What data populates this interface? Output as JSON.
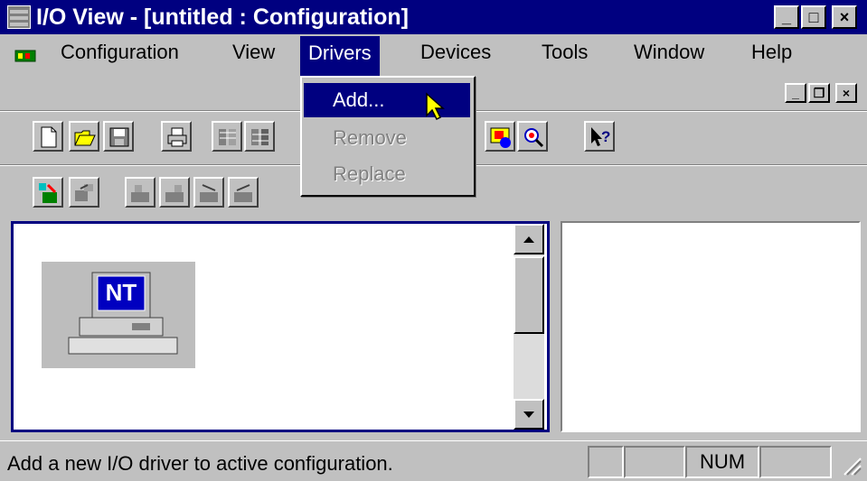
{
  "window": {
    "title": "I/O View - [untitled : Configuration]",
    "caption_buttons": {
      "minimize": "_",
      "maximize": "□",
      "close": "×"
    }
  },
  "menubar": {
    "items": [
      {
        "label": "Configuration",
        "accel": "C"
      },
      {
        "label": "View",
        "accel": "V"
      },
      {
        "label": "Drivers",
        "accel": "D"
      },
      {
        "label": "Devices",
        "accel": "e"
      },
      {
        "label": "Tools",
        "accel": "T"
      },
      {
        "label": "Window",
        "accel": "W"
      },
      {
        "label": "Help",
        "accel": "H"
      }
    ],
    "active": "Drivers",
    "mdi_buttons": {
      "minimize": "_",
      "restore": "❐",
      "close": "×"
    }
  },
  "drivers_menu": {
    "items": [
      {
        "label": "Add...",
        "state": "highlighted"
      },
      {
        "label": "Remove",
        "state": "disabled"
      },
      {
        "label": "Replace",
        "state": "disabled"
      }
    ]
  },
  "toolbar_row1": [
    "new-document",
    "open-folder",
    "save",
    "print",
    "cut",
    "paste",
    "device-config",
    "zoom",
    "context-help"
  ],
  "toolbar_row2": [
    "driver-add",
    "driver-remove",
    "device-1",
    "device-2",
    "device-3",
    "device-4"
  ],
  "left_pane": {
    "computer_icon_label": "NT"
  },
  "statusbar": {
    "message": "Add a new I/O driver to active configuration.",
    "indicators": [
      "",
      "",
      "NUM",
      ""
    ]
  },
  "colors": {
    "titlebar": "#000080",
    "face": "#c0c0c0",
    "highlight": "#000080"
  }
}
